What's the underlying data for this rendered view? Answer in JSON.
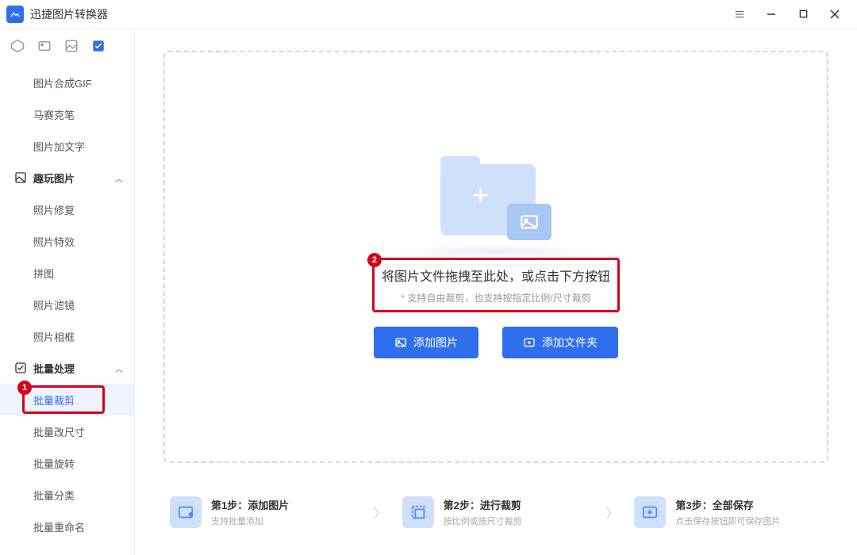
{
  "app_title": "迅捷图片转换器",
  "sidebar": {
    "items1": [
      "图片合成GIF",
      "马赛克笔",
      "图片加文字"
    ],
    "group1": "趣玩图片",
    "items2": [
      "照片修复",
      "照片特效",
      "拼图",
      "照片滤镜",
      "照片相框"
    ],
    "group2": "批量处理",
    "items3": [
      "批量裁剪",
      "批量改尺寸",
      "批量旋转",
      "批量分类",
      "批量重命名"
    ]
  },
  "dropzone": {
    "title": "将图片文件拖拽至此处，或点击下方按钮",
    "subtitle": "* 支持自由裁剪，也支持按指定比例/尺寸裁剪",
    "btn_add_image": "添加图片",
    "btn_add_folder": "添加文件夹"
  },
  "steps": [
    {
      "title": "第1步：添加图片",
      "desc": "支持批量添加"
    },
    {
      "title": "第2步：进行裁剪",
      "desc": "按比例或按尺寸裁剪"
    },
    {
      "title": "第3步：全部保存",
      "desc": "点击保存按钮即可保存图片"
    }
  ],
  "annotations": {
    "badge1": "1",
    "badge2": "2"
  }
}
